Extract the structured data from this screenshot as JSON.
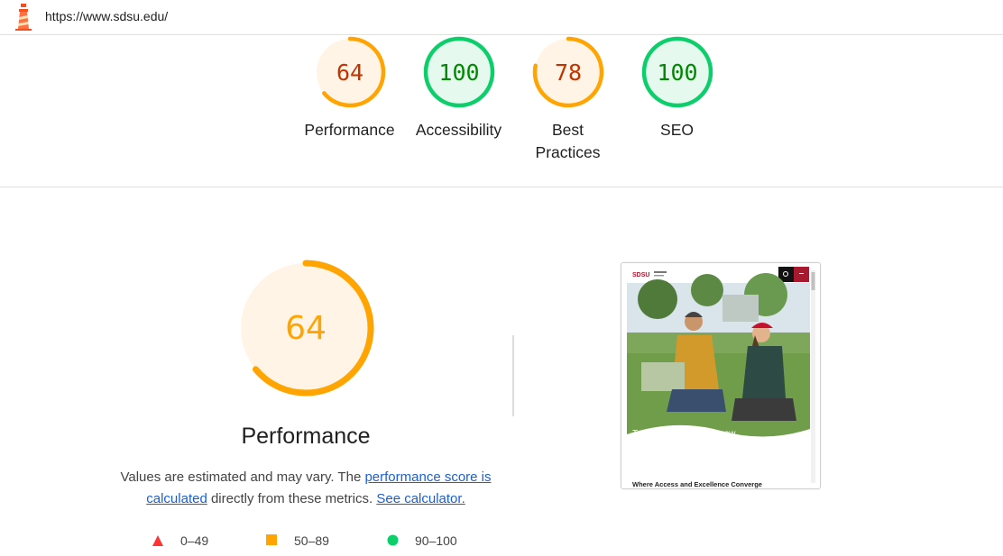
{
  "header": {
    "url": "https://www.sdsu.edu/"
  },
  "colors": {
    "fail": "#ff3333",
    "average": "#ffa400",
    "average_text": "#c33300",
    "pass": "#0cce6b",
    "pass_text": "#008800",
    "link": "#1a5fd6"
  },
  "summary": {
    "gauges": [
      {
        "score": "64",
        "label": "Performance",
        "rating": "average",
        "value": 64
      },
      {
        "score": "100",
        "label": "Accessibility",
        "rating": "pass",
        "value": 100
      },
      {
        "score": "78",
        "label": "Best Practices",
        "rating": "average",
        "value": 78
      },
      {
        "score": "100",
        "label": "SEO",
        "rating": "pass",
        "value": 100
      }
    ]
  },
  "performance": {
    "score": "64",
    "value": 64,
    "title": "Performance",
    "desc_prefix": "Values are estimated and may vary. The ",
    "desc_link1": "performance score is calculated",
    "desc_middle": " directly from these metrics. ",
    "desc_link2": "See calculator."
  },
  "legend": {
    "fail": "0–49",
    "average": "50–89",
    "pass": "90–100"
  },
  "screenshot": {
    "logo_text": "SDSU",
    "hero_text": "Transform Your Tomorrow",
    "headline": "Where Access and Excellence Converge"
  }
}
